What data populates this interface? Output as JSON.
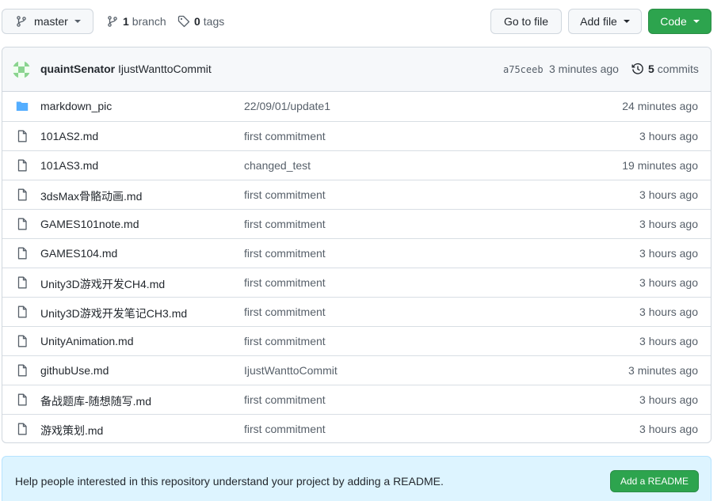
{
  "toolbar": {
    "branch_label": "master",
    "branches_count": "1",
    "branches_label": "branch",
    "tags_count": "0",
    "tags_label": "tags",
    "goto_file_label": "Go to file",
    "add_file_label": "Add file",
    "code_label": "Code"
  },
  "commit": {
    "author": "quaintSenator",
    "message": "IjustWanttoCommit",
    "sha": "a75ceeb",
    "time": "3 minutes ago",
    "count": "5",
    "count_label": "commits"
  },
  "files": [
    {
      "name": "markdown_pic",
      "type": "folder",
      "message": "22/09/01/update1",
      "time": "24 minutes ago"
    },
    {
      "name": "101AS2.md",
      "type": "file",
      "message": "first commitment",
      "time": "3 hours ago"
    },
    {
      "name": "101AS3.md",
      "type": "file",
      "message": "changed_test",
      "time": "19 minutes ago"
    },
    {
      "name": "3dsMax骨骼动画.md",
      "type": "file",
      "message": "first commitment",
      "time": "3 hours ago"
    },
    {
      "name": "GAMES101note.md",
      "type": "file",
      "message": "first commitment",
      "time": "3 hours ago"
    },
    {
      "name": "GAMES104.md",
      "type": "file",
      "message": "first commitment",
      "time": "3 hours ago"
    },
    {
      "name": "Unity3D游戏开发CH4.md",
      "type": "file",
      "message": "first commitment",
      "time": "3 hours ago"
    },
    {
      "name": "Unity3D游戏开发笔记CH3.md",
      "type": "file",
      "message": "first commitment",
      "time": "3 hours ago"
    },
    {
      "name": "UnityAnimation.md",
      "type": "file",
      "message": "first commitment",
      "time": "3 hours ago"
    },
    {
      "name": "githubUse.md",
      "type": "file",
      "message": "IjustWanttoCommit",
      "time": "3 minutes ago"
    },
    {
      "name": "备战题库-随想随写.md",
      "type": "file",
      "message": "first commitment",
      "time": "3 hours ago"
    },
    {
      "name": "游戏策划.md",
      "type": "file",
      "message": "first commitment",
      "time": "3 hours ago"
    }
  ],
  "readme": {
    "text": "Help people interested in this repository understand your project by adding a README.",
    "button_label": "Add a README"
  },
  "colors": {
    "primary_button": "#2da44e",
    "folder_icon": "#54aeff",
    "readme_bg": "#ddf4ff"
  }
}
